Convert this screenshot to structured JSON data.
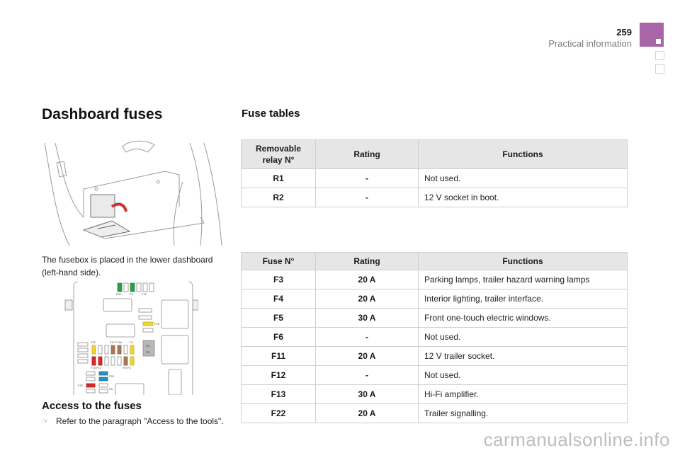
{
  "header": {
    "page_number": "259",
    "section": "Practical information",
    "accent_color": "#a866a8"
  },
  "left": {
    "title": "Dashboard fuses",
    "description": "The fusebox is placed in the lower dashboard (left-hand side).",
    "illustration_1": "glovebox-fusebox-access-illustration",
    "illustration_2": "fusebox-layout-diagram",
    "fusebox_labels": [
      "F30",
      "F9",
      "F12",
      "F15",
      "F22",
      "F17",
      "F15b",
      "F4",
      "R1",
      "R2",
      "F14",
      "F13",
      "F6",
      "F3",
      "F25",
      "F32",
      "F8"
    ],
    "access_title": "Access to the fuses",
    "access_bullet_icon": "pointing-hand-icon",
    "access_text": "Refer to the paragraph \"Access to the tools\"."
  },
  "tables": {
    "title": "Fuse tables",
    "relay_table": {
      "headers": [
        "Removable relay N°",
        "Rating",
        "Functions"
      ],
      "rows": [
        {
          "id": "R1",
          "rating": "-",
          "function": "Not used."
        },
        {
          "id": "R2",
          "rating": "-",
          "function": "12 V socket in boot."
        }
      ]
    },
    "fuse_table": {
      "headers": [
        "Fuse N°",
        "Rating",
        "Functions"
      ],
      "rows": [
        {
          "id": "F3",
          "rating": "20 A",
          "function": "Parking lamps, trailer hazard warning lamps"
        },
        {
          "id": "F4",
          "rating": "20 A",
          "function": "Interior lighting, trailer interface."
        },
        {
          "id": "F5",
          "rating": "30 A",
          "function": "Front one-touch electric windows."
        },
        {
          "id": "F6",
          "rating": "-",
          "function": "Not used."
        },
        {
          "id": "F11",
          "rating": "20 A",
          "function": "12 V trailer socket."
        },
        {
          "id": "F12",
          "rating": "-",
          "function": "Not used."
        },
        {
          "id": "F13",
          "rating": "30 A",
          "function": "Hi-Fi amplifier."
        },
        {
          "id": "F22",
          "rating": "20 A",
          "function": "Trailer signalling."
        }
      ]
    }
  },
  "watermark": "carmanualsonline.info"
}
